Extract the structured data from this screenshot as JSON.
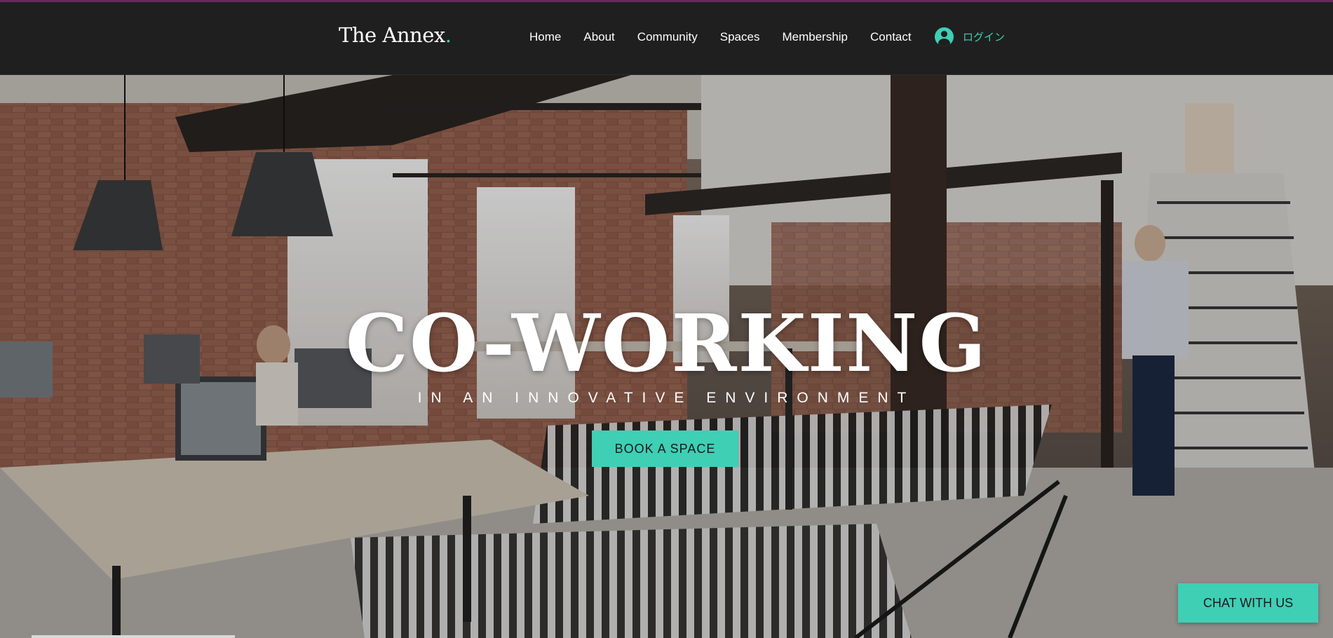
{
  "header": {
    "logo_text": "The Annex",
    "logo_dot": ".",
    "nav": [
      "Home",
      "About",
      "Community",
      "Spaces",
      "Membership",
      "Contact"
    ],
    "login_label": "ログイン",
    "login_icon": "user-avatar-icon"
  },
  "hero": {
    "headline": "CO-WORKING",
    "subline": "IN AN INNOVATIVE ENVIRONMENT",
    "cta_label": "BOOK A SPACE"
  },
  "chat": {
    "label": "CHAT WITH US"
  },
  "colors": {
    "accent": "#3ecfb5",
    "header_bg": "#1f1f1f",
    "top_line": "#6b2a5e"
  }
}
